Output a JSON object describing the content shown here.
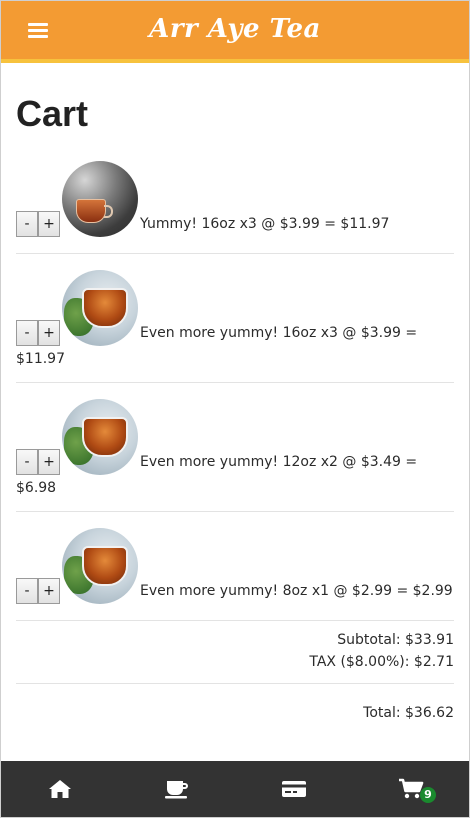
{
  "app": {
    "title": "Arr Aye Tea"
  },
  "page": {
    "title": "Cart"
  },
  "cart": {
    "items": [
      {
        "minus_label": "-",
        "plus_label": "+",
        "icon": "black-tea-cup-image",
        "line": "Yummy! 16oz x3 @ $3.99 = $11.97"
      },
      {
        "minus_label": "-",
        "plus_label": "+",
        "icon": "amber-tea-cup-image",
        "line_a": "Even more yummy! 16oz x3 @ $3.99 =",
        "line_b": "$11.97"
      },
      {
        "minus_label": "-",
        "plus_label": "+",
        "icon": "amber-tea-cup-image",
        "line_a": "Even more yummy! 12oz x2 @ $3.49 =",
        "line_b": "$6.98"
      },
      {
        "minus_label": "-",
        "plus_label": "+",
        "icon": "amber-tea-cup-image",
        "line": "Even more yummy! 8oz x1 @ $2.99 = $2.99"
      }
    ],
    "subtotal": "Subtotal: $33.91",
    "tax": "TAX ($8.00%): $2.71",
    "total": "Total: $36.62"
  },
  "nav": {
    "items": [
      {
        "icon": "home-icon"
      },
      {
        "icon": "tea-cup-icon"
      },
      {
        "icon": "credit-card-icon"
      },
      {
        "icon": "shopping-cart-icon",
        "badge": "9"
      }
    ]
  },
  "colors": {
    "header": "#f39b33",
    "header_border": "#f7c23d",
    "nav_bg": "#333333",
    "badge": "#1a8a2e"
  }
}
